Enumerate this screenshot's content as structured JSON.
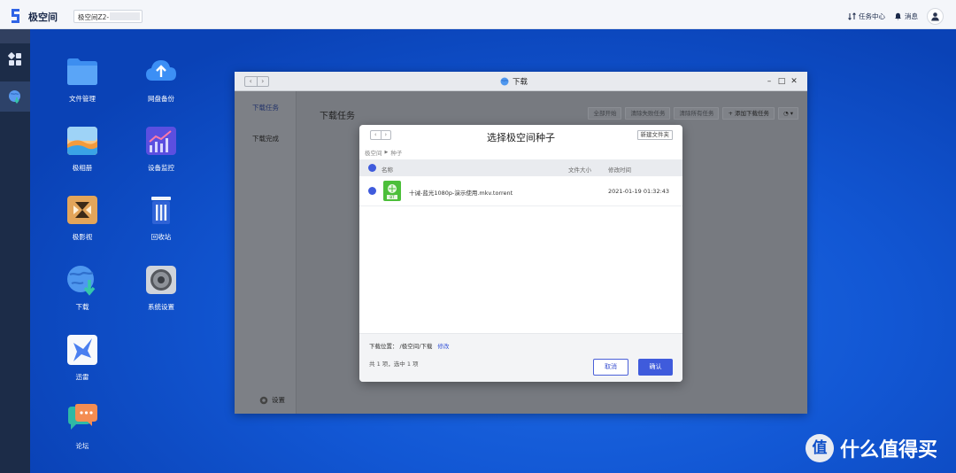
{
  "topbar": {
    "brand": "极空间",
    "device_name": "极空间Z2-",
    "task_center": "任务中心",
    "messages": "消息"
  },
  "desktop": {
    "apps": [
      {
        "label": "文件管理",
        "icon": "folder-icon"
      },
      {
        "label": "网盘备份",
        "icon": "cloud-upload-icon"
      },
      {
        "label": "极相册",
        "icon": "photo-album-icon"
      },
      {
        "label": "设备监控",
        "icon": "monitor-chart-icon"
      },
      {
        "label": "极影视",
        "icon": "video-icon"
      },
      {
        "label": "回收站",
        "icon": "trash-icon"
      },
      {
        "label": "下载",
        "icon": "download-globe-icon"
      },
      {
        "label": "系统设置",
        "icon": "settings-gear-icon"
      },
      {
        "label": "迅雷",
        "icon": "thunder-bird-icon"
      },
      {
        "label": "论坛",
        "icon": "forum-chat-icon"
      }
    ]
  },
  "download_window": {
    "title": "下载",
    "sidebar": {
      "tasks": "下载任务",
      "completed": "下载完成",
      "settings": "设置"
    },
    "heading": "下载任务",
    "toolbar": [
      "全部开始",
      "清除失败任务",
      "清除所有任务",
      "添加下载任务"
    ]
  },
  "dialog": {
    "title": "选择极空间种子",
    "new_folder": "新建文件夹",
    "breadcrumb": [
      "极空间",
      "种子"
    ],
    "columns": {
      "name": "名称",
      "size": "文件大小",
      "modified": "修改时间"
    },
    "file": {
      "name": "十诫-蓝光1080p-演示使用.mkv.torrent",
      "size": "",
      "modified": "2021-01-19 01:32:43",
      "badge": "BT"
    },
    "location_label": "下载位置：",
    "location_path": "/极空间/下载",
    "modify": "修改",
    "count": "共 1 项，选中 1 项",
    "cancel": "取消",
    "confirm": "确认"
  },
  "watermark": {
    "logo_char": "值",
    "text": "什么值得买"
  }
}
